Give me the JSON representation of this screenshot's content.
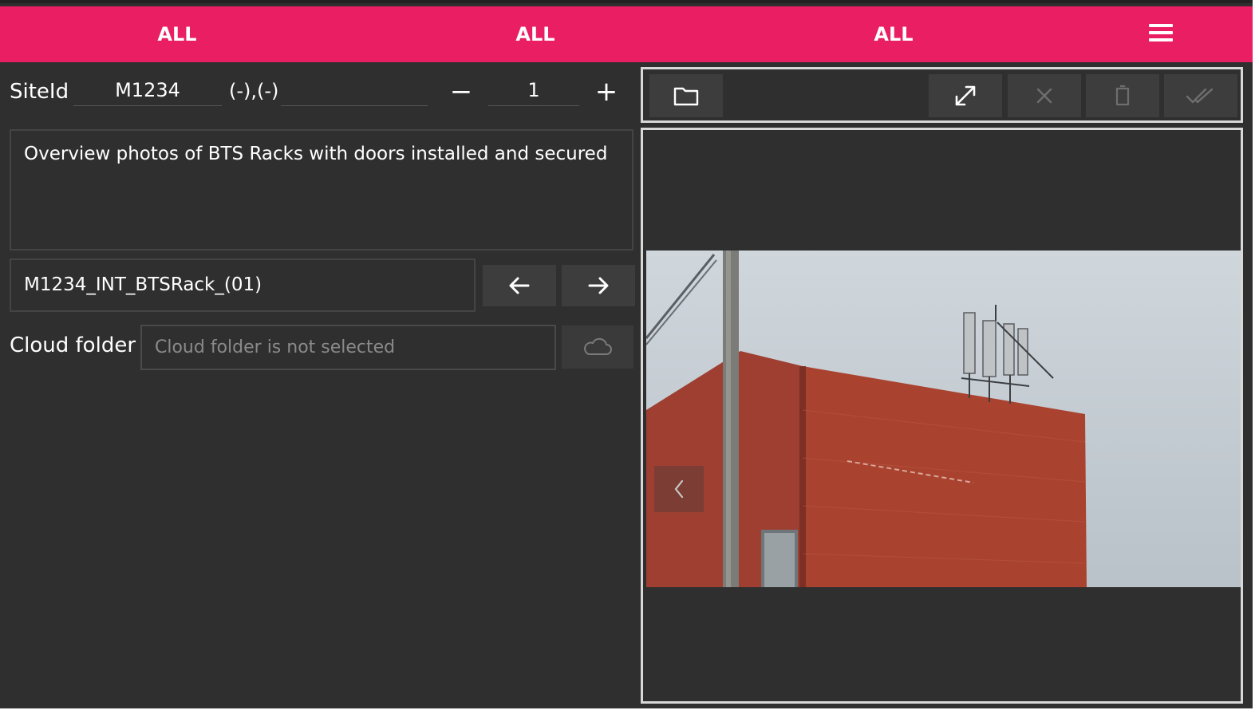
{
  "tabs": [
    {
      "label": "ALL"
    },
    {
      "label": "ALL"
    },
    {
      "label": "ALL"
    }
  ],
  "site": {
    "label": "SiteId",
    "value": "M1234",
    "coords": "(-),(-)",
    "coords_value": ""
  },
  "counter": {
    "value": "1",
    "minus": "−",
    "plus": "+"
  },
  "description": "Overview photos of BTS Racks with doors installed and secured",
  "file_name": "M1234_INT_BTSRack_(01)",
  "cloud": {
    "label": "Cloud folder",
    "placeholder": "Cloud folder is not selected"
  },
  "colors": {
    "accent": "#e91e63",
    "background": "#2f2f2f",
    "button": "#3d3d3d"
  },
  "icons": {
    "menu": "hamburger-icon",
    "folder": "folder-icon",
    "expand": "expand-icon",
    "close": "close-icon",
    "delete": "trash-icon",
    "confirm": "double-check-icon",
    "cloud": "cloud-icon",
    "prev": "chevron-left-icon",
    "back": "arrow-left-icon",
    "forward": "arrow-right-icon"
  }
}
